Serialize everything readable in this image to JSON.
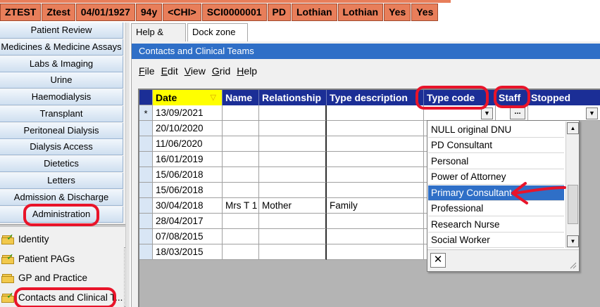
{
  "banner": {
    "cells": [
      "ZTEST",
      "Ztest",
      "04/01/1927",
      "94y",
      "<CHI>",
      "SCI0000001",
      "PD",
      "Lothian",
      "Lothian",
      "Yes",
      "Yes"
    ]
  },
  "sidebar": {
    "nav_items": [
      "Patient Review",
      "Medicines & Medicine Assays",
      "Labs & Imaging",
      "Urine",
      "Haemodialysis",
      "Transplant",
      "Peritoneal Dialysis",
      "Dialysis Access",
      "Dietetics",
      "Letters",
      "Admission & Discharge",
      "Administration"
    ],
    "sub_items": [
      {
        "label": "Identity",
        "icon": "folder-check-icon"
      },
      {
        "label": "Patient PAGs",
        "icon": "folder-check-icon"
      },
      {
        "label": "GP and Practice",
        "icon": "folder-icon"
      },
      {
        "label": "Contacts and Clinical T...",
        "icon": "folder-check-icon"
      }
    ]
  },
  "tabs": [
    "Help & Info",
    "Dock zone"
  ],
  "panel": {
    "title": "Contacts and Clinical Teams",
    "menu": [
      {
        "label": "File",
        "accel": "F",
        "rest": "ile"
      },
      {
        "label": "Edit",
        "accel": "E",
        "rest": "dit"
      },
      {
        "label": "View",
        "accel": "V",
        "rest": "iew"
      },
      {
        "label": "Grid",
        "accel": "G",
        "rest": "rid"
      },
      {
        "label": "Help",
        "accel": "H",
        "rest": "elp"
      }
    ]
  },
  "grid": {
    "columns": [
      "Date",
      "Name",
      "Relationship",
      "Type description",
      "Type code",
      "Staff",
      "Stopped"
    ],
    "new_row_marker": "*",
    "new_row_date": "13/09/2021",
    "rows": [
      {
        "date": "20/10/2020",
        "name": "",
        "relationship": "",
        "type_description": ""
      },
      {
        "date": "11/06/2020",
        "name": "",
        "relationship": "",
        "type_description": ""
      },
      {
        "date": "16/01/2019",
        "name": "",
        "relationship": "",
        "type_description": ""
      },
      {
        "date": "15/06/2018",
        "name": "",
        "relationship": "",
        "type_description": ""
      },
      {
        "date": "15/06/2018",
        "name": "",
        "relationship": "",
        "type_description": ""
      },
      {
        "date": "30/04/2018",
        "name": "Mrs T 1",
        "relationship": "Mother",
        "type_description": "Family"
      },
      {
        "date": "28/04/2017",
        "name": "",
        "relationship": "",
        "type_description": ""
      },
      {
        "date": "07/08/2015",
        "name": "",
        "relationship": "",
        "type_description": ""
      },
      {
        "date": "18/03/2015",
        "name": "",
        "relationship": "",
        "type_description": ""
      }
    ]
  },
  "dropdown": {
    "options": [
      "NULL original DNU",
      "PD Consultant",
      "Personal",
      "Power of Attorney",
      "Primary Consultant",
      "Professional",
      "Research Nurse",
      "Social Worker"
    ],
    "selected": "Primary Consultant",
    "close_glyph": "✕"
  },
  "colors": {
    "banner": "#e87e5a",
    "panel_title": "#2f6fc7",
    "grid_header": "#1b2e96",
    "date_header": "#ffff00",
    "annotation": "#e8142a"
  }
}
